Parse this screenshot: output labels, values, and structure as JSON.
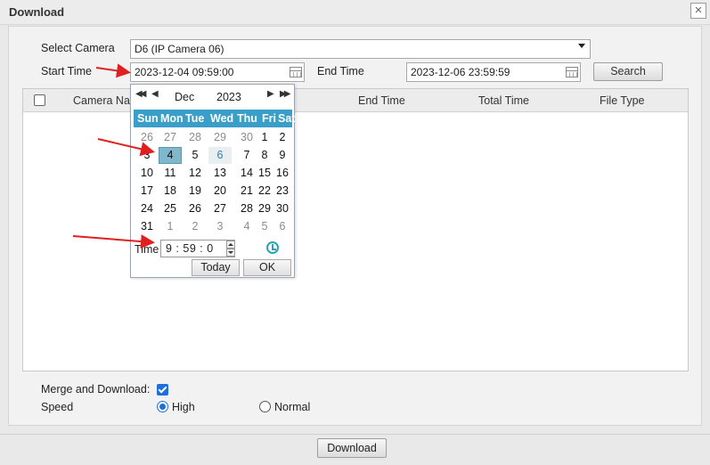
{
  "window": {
    "title": "Download",
    "close_glyph": "×"
  },
  "form": {
    "camera_label": "Select Camera",
    "camera_value": "D6 (IP Camera 06)",
    "start_label": "Start Time",
    "start_value": "2023-12-04 09:59:00",
    "end_label": "End Time",
    "end_value": "2023-12-06 23:59:59",
    "search_label": "Search"
  },
  "table": {
    "headers": [
      "Camera Na",
      "End Time",
      "Total Time",
      "File Type"
    ]
  },
  "calendar": {
    "month": "Dec",
    "year": "2023",
    "nav": {
      "prev_year": "◀◀",
      "prev_month": "◀",
      "next_month": "▶",
      "next_year": "▶▶"
    },
    "weekdays": [
      "Sun",
      "Mon",
      "Tue",
      "Wed",
      "Thu",
      "Fri",
      "Sat"
    ],
    "weeks": [
      [
        "26",
        "27",
        "28",
        "29",
        "30",
        "1",
        "2"
      ],
      [
        "3",
        "4",
        "5",
        "6",
        "7",
        "8",
        "9"
      ],
      [
        "10",
        "11",
        "12",
        "13",
        "14",
        "15",
        "16"
      ],
      [
        "17",
        "18",
        "19",
        "20",
        "21",
        "22",
        "23"
      ],
      [
        "24",
        "25",
        "26",
        "27",
        "28",
        "29",
        "30"
      ],
      [
        "31",
        "1",
        "2",
        "3",
        "4",
        "5",
        "6"
      ]
    ],
    "selected_day": "4",
    "today_day": "6",
    "time_label": "Time",
    "time_value": "9 : 59 : 0",
    "today_button": "Today",
    "ok_button": "OK"
  },
  "options": {
    "merge_label": "Merge and Download:",
    "merge_checked": true,
    "speed_label": "Speed",
    "speed_high": "High",
    "speed_normal": "Normal",
    "speed_selected": "High"
  },
  "footer": {
    "download_label": "Download"
  },
  "colors": {
    "accent": "#1e6fd9",
    "calendar_header": "#3a9fc8",
    "annotation": "#e02020"
  }
}
